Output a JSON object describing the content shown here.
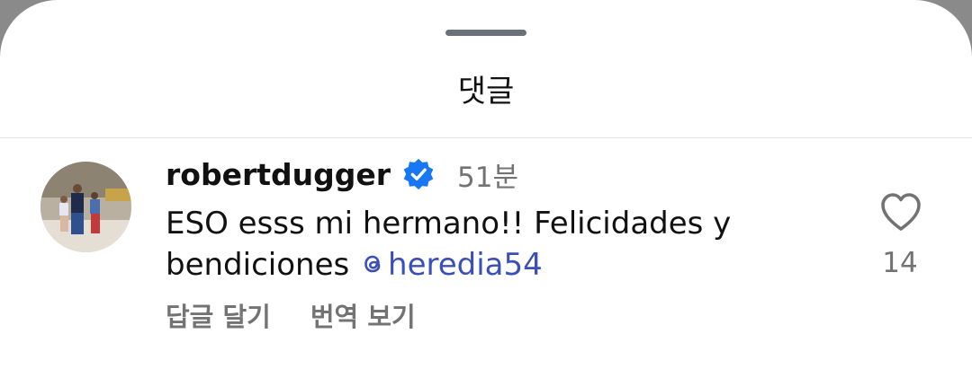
{
  "sheet": {
    "title": "댓글"
  },
  "comment": {
    "username": "robertdugger",
    "time": "51분",
    "text": "ESO esss mi hermano!! Felicidades y bendiciones ",
    "mention": "heredia54",
    "likes": "14",
    "actions": {
      "reply": "답글 달기",
      "translate": "번역 보기"
    },
    "verified": true
  },
  "colors": {
    "mention": "#3b4fb8",
    "verified_badge": "#1877f2",
    "muted_text": "#737373"
  },
  "icons": {
    "verified": "verified-badge-icon",
    "like": "heart-outline-icon",
    "mention": "threads-logo-icon"
  }
}
